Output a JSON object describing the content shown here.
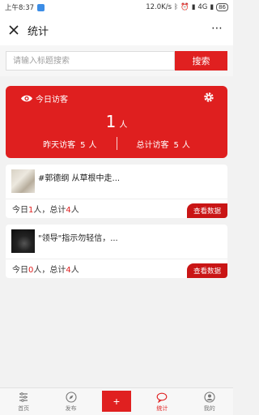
{
  "status_bar": {
    "time": "上午8:37",
    "network_speed": "12.0K/s",
    "signal_label": "4G",
    "battery": "86"
  },
  "header": {
    "title": "统计",
    "close_icon": "close-icon",
    "more_icon": "more-icon",
    "more_glyph": "⋯"
  },
  "search": {
    "placeholder": "请输入标题搜索",
    "button_label": "搜索"
  },
  "stats": {
    "today_label": "今日访客",
    "today_value": "1",
    "unit": "人",
    "yesterday_label": "昨天访客",
    "yesterday_value": "5",
    "total_label": "总计访客",
    "total_value": "5",
    "accent_color": "#df1f1f"
  },
  "articles": [
    {
      "title": "#郭德纲 从草根中走...",
      "today_prefix": "今日",
      "today_count": "1",
      "mid": "人，总计",
      "total_count": "4",
      "suffix": "人",
      "button_label": "查看数据"
    },
    {
      "title": "\"领导\"指示勿轻信，...",
      "today_prefix": "今日",
      "today_count": "0",
      "mid": "人，总计",
      "total_count": "4",
      "suffix": "人",
      "button_label": "查看数据"
    }
  ],
  "bottom_nav": {
    "home": "首页",
    "publish": "发布",
    "add": "+",
    "stats": "统计",
    "mine": "我的"
  }
}
